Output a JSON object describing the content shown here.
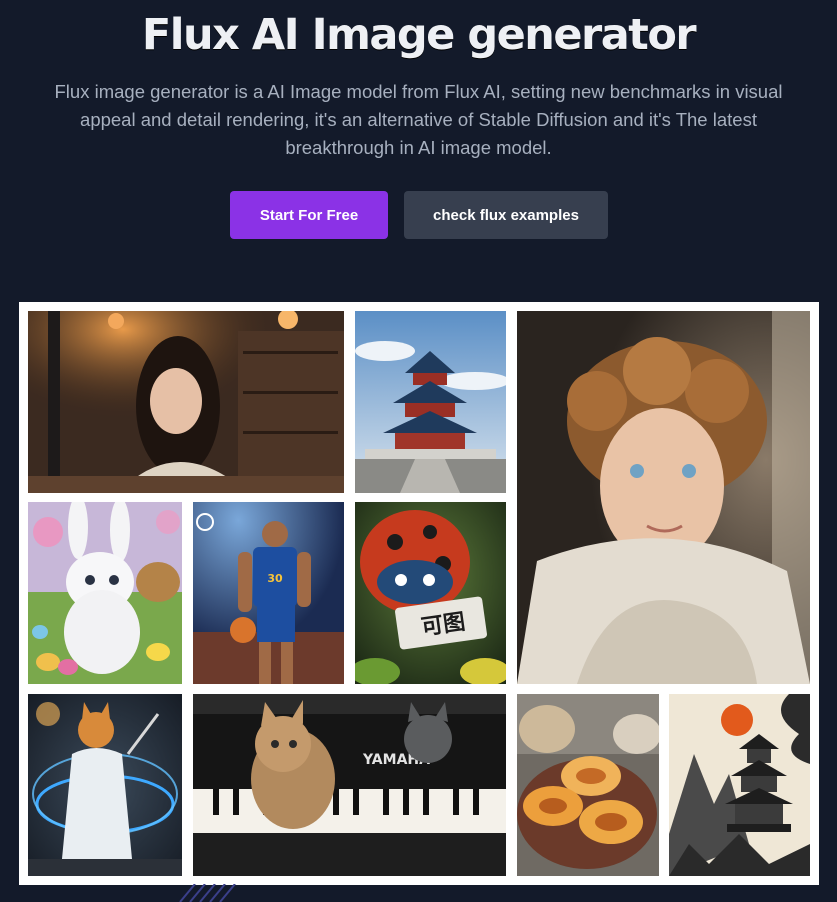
{
  "hero": {
    "title": "Flux AI Image generator",
    "subtitle": "Flux image generator is a AI Image model from Flux AI, setting new benchmarks in visual appeal and detail rendering, it's an alternative of Stable Diffusion and it's The latest breakthrough in AI image model."
  },
  "buttons": {
    "primary_label": "Start For Free",
    "secondary_label": "check flux examples"
  },
  "gallery": {
    "images": [
      {
        "subject": "woman in cafe"
      },
      {
        "subject": "temple of heaven"
      },
      {
        "subject": "curly haired boy"
      },
      {
        "subject": "white bunny with easter eggs"
      },
      {
        "subject": "basketball player",
        "jersey_text": "30"
      },
      {
        "subject": "ladybug holding sign",
        "sign_text": "可图"
      },
      {
        "subject": "wizard cat"
      },
      {
        "subject": "kittens playing piano",
        "brand_text": "YAMAHA"
      },
      {
        "subject": "mooncakes and tea"
      },
      {
        "subject": "ink painting pagoda"
      }
    ]
  },
  "colors": {
    "background": "#131a2a",
    "primary_button": "#8b32e6",
    "secondary_button": "#373f4f",
    "title": "#eef0f4",
    "subtitle": "#a7b0bf"
  }
}
